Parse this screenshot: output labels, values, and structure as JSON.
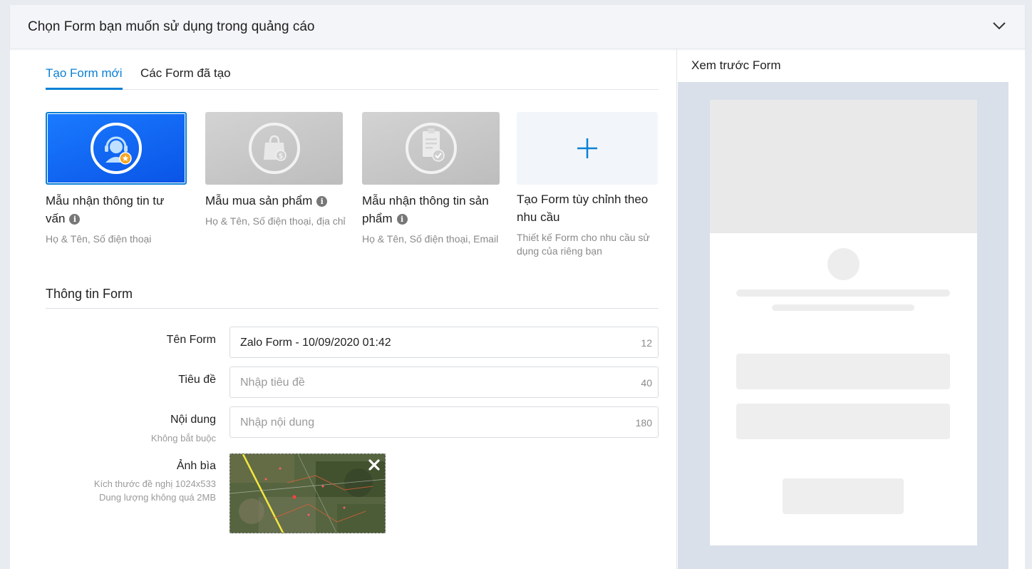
{
  "header": {
    "title": "Chọn Form bạn muốn sử dụng trong quảng cáo",
    "collapse_icon": "chevron-down-icon"
  },
  "tabs": [
    {
      "label": "Tạo Form mới",
      "active": true
    },
    {
      "label": "Các Form đã tạo",
      "active": false
    }
  ],
  "templates": [
    {
      "title": "Mẫu nhận thông tin tư vấn",
      "desc": "Họ & Tên, Số điện thoại",
      "icon": "support-agent-icon",
      "selected": true
    },
    {
      "title": "Mẫu mua sản phẩm",
      "desc": "Họ & Tên, Số điện thoại, địa chỉ",
      "icon": "shopping-bag-icon",
      "selected": false
    },
    {
      "title": "Mẫu nhận thông tin sản phẩm",
      "desc": "Họ & Tên, Số điện thoại, Email",
      "icon": "clipboard-check-icon",
      "selected": false
    },
    {
      "title": "Tạo Form tùy chỉnh theo nhu cầu",
      "desc": "Thiết kế Form cho nhu cầu sử dụng của riêng bạn",
      "icon": "plus-icon",
      "selected": false
    }
  ],
  "form_info": {
    "section_title": "Thông tin Form",
    "name": {
      "label": "Tên Form",
      "value": "Zalo Form - 10/09/2020 01:42",
      "count": "12"
    },
    "title": {
      "label": "Tiêu đề",
      "placeholder": "Nhập tiêu đề",
      "count": "40"
    },
    "content": {
      "label": "Nội dung",
      "sub": "Không bắt buộc",
      "placeholder": "Nhập nội dung",
      "count": "180"
    },
    "cover": {
      "label": "Ảnh bìa",
      "sub1": "Kích thước đề nghị 1024x533",
      "sub2": "Dung lượng không quá 2MB"
    }
  },
  "preview": {
    "title": "Xem trước Form"
  },
  "colors": {
    "accent": "#0a80d4",
    "selected_card": "#0a54e6",
    "preview_bg": "#d9e0ea"
  }
}
